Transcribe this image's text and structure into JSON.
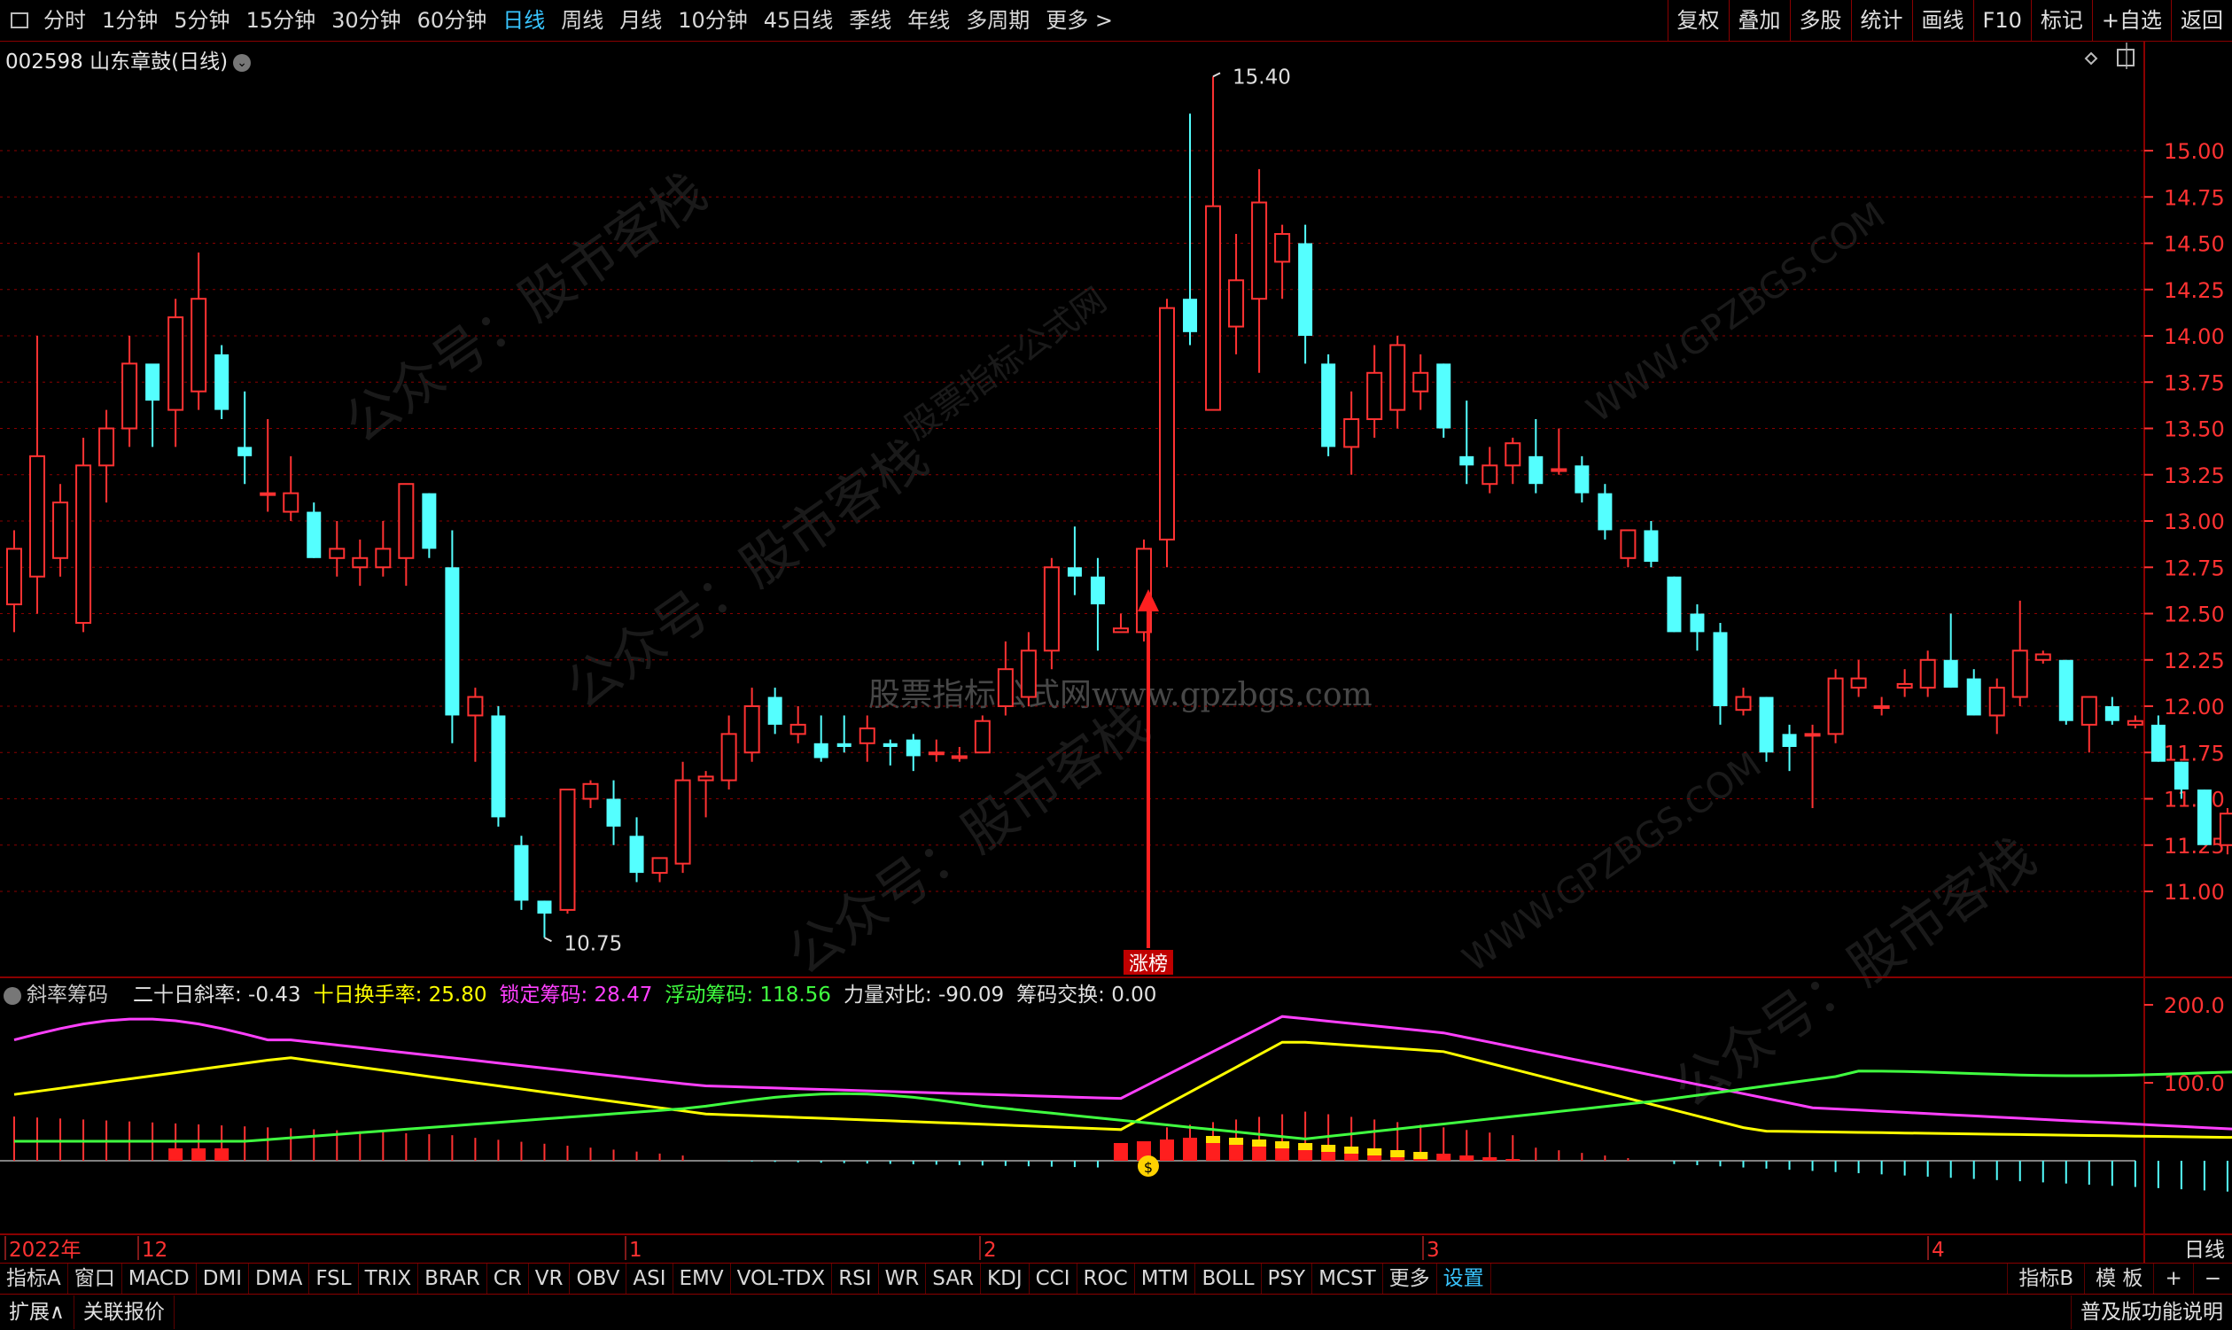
{
  "toolbar": {
    "periods": [
      "分时",
      "1分钟",
      "5分钟",
      "15分钟",
      "30分钟",
      "60分钟",
      "日线",
      "周线",
      "月线",
      "10分钟",
      "45日线",
      "季线",
      "年线",
      "多周期",
      "更多 >"
    ],
    "active_period": "日线",
    "right_buttons": [
      "复权",
      "叠加",
      "多股",
      "统计",
      "画线",
      "F10",
      "标记",
      "+自选",
      "返回"
    ]
  },
  "stock": {
    "title": "002598 山东章鼓(日线)"
  },
  "indicator": {
    "name": "斜率筹码",
    "values": [
      {
        "label": "二十日斜率: -0.43",
        "color": "#e0e0e0"
      },
      {
        "label": "十日换手率: 25.80",
        "color": "#ffff00"
      },
      {
        "label": "锁定筹码: 28.47",
        "color": "#ff40ff"
      },
      {
        "label": "浮动筹码: 118.56",
        "color": "#40ff40"
      },
      {
        "label": "力量对比: -90.09",
        "color": "#e0e0e0"
      },
      {
        "label": "筹码交换: 0.00",
        "color": "#e0e0e0"
      }
    ]
  },
  "bottom_tabs": [
    "指标A",
    "窗口",
    "MACD",
    "DMI",
    "DMA",
    "FSL",
    "TRIX",
    "BRAR",
    "CR",
    "VR",
    "OBV",
    "ASI",
    "EMV",
    "VOL-TDX",
    "RSI",
    "WR",
    "SAR",
    "KDJ",
    "CCI",
    "ROC",
    "MTM",
    "BOLL",
    "PSY",
    "MCST",
    "更多",
    "设置"
  ],
  "bottom_active": "设置",
  "bottom_right": [
    "指标B",
    "模 板",
    "+",
    "−"
  ],
  "status": {
    "left": [
      "扩展∧",
      "关联报价"
    ],
    "right": "普及版功能说明"
  },
  "watermarks": [
    "公众号：股市客栈",
    "股票指标公式网",
    "WWW.GPZBGS.COM"
  ],
  "watermark_center": "股票指标公式网www.gpzbgs.com",
  "colors": {
    "up": "#ff3232",
    "down": "#54ffff",
    "grid": "#8a0000",
    "axis": "#ff3232"
  },
  "chart_data": {
    "type": "candlestick",
    "price_axis": {
      "ticks": [
        11.0,
        11.25,
        11.5,
        11.75,
        12.0,
        12.25,
        12.5,
        12.75,
        13.0,
        13.25,
        13.5,
        13.75,
        14.0,
        14.25,
        14.5,
        14.75,
        15.0
      ],
      "ylim": [
        10.55,
        15.45
      ]
    },
    "indicator_axis": {
      "ticks": [
        100.0,
        200.0
      ]
    },
    "x_labels": [
      "2022年",
      "12",
      "1",
      "2",
      "3",
      "4"
    ],
    "period_label": "日线",
    "annotations": {
      "high": "15.40",
      "low": "10.75",
      "event": "涨榜"
    },
    "candles": [
      {
        "o": 12.55,
        "h": 12.95,
        "l": 12.4,
        "c": 12.85
      },
      {
        "o": 12.7,
        "h": 14.0,
        "l": 12.5,
        "c": 13.35
      },
      {
        "o": 12.8,
        "h": 13.2,
        "l": 12.7,
        "c": 13.1
      },
      {
        "o": 12.45,
        "h": 13.45,
        "l": 12.4,
        "c": 13.3
      },
      {
        "o": 13.3,
        "h": 13.6,
        "l": 13.1,
        "c": 13.5
      },
      {
        "o": 13.5,
        "h": 14.0,
        "l": 13.4,
        "c": 13.85
      },
      {
        "o": 13.85,
        "h": 13.75,
        "l": 13.4,
        "c": 13.65
      },
      {
        "o": 13.6,
        "h": 14.2,
        "l": 13.4,
        "c": 14.1
      },
      {
        "o": 13.7,
        "h": 14.45,
        "l": 13.6,
        "c": 14.2
      },
      {
        "o": 13.9,
        "h": 13.95,
        "l": 13.55,
        "c": 13.6
      },
      {
        "o": 13.4,
        "h": 13.7,
        "l": 13.2,
        "c": 13.35
      },
      {
        "o": 13.15,
        "h": 13.55,
        "l": 13.05,
        "c": 13.15
      },
      {
        "o": 13.05,
        "h": 13.35,
        "l": 13.0,
        "c": 13.15
      },
      {
        "o": 13.05,
        "h": 13.1,
        "l": 12.8,
        "c": 12.8
      },
      {
        "o": 12.8,
        "h": 13.0,
        "l": 12.7,
        "c": 12.85
      },
      {
        "o": 12.75,
        "h": 12.9,
        "l": 12.65,
        "c": 12.8
      },
      {
        "o": 12.75,
        "h": 13.0,
        "l": 12.7,
        "c": 12.85
      },
      {
        "o": 12.8,
        "h": 13.2,
        "l": 12.65,
        "c": 13.2
      },
      {
        "o": 13.15,
        "h": 13.15,
        "l": 12.8,
        "c": 12.85
      },
      {
        "o": 12.75,
        "h": 12.95,
        "l": 11.8,
        "c": 11.95
      },
      {
        "o": 11.95,
        "h": 12.1,
        "l": 11.7,
        "c": 12.05
      },
      {
        "o": 11.95,
        "h": 12.0,
        "l": 11.35,
        "c": 11.4
      },
      {
        "o": 11.25,
        "h": 11.3,
        "l": 10.9,
        "c": 10.95
      },
      {
        "o": 10.95,
        "h": 10.95,
        "l": 10.75,
        "c": 10.88
      },
      {
        "o": 10.9,
        "h": 11.55,
        "l": 10.88,
        "c": 11.55
      },
      {
        "o": 11.5,
        "h": 11.6,
        "l": 11.45,
        "c": 11.58
      },
      {
        "o": 11.5,
        "h": 11.6,
        "l": 11.25,
        "c": 11.35
      },
      {
        "o": 11.3,
        "h": 11.4,
        "l": 11.05,
        "c": 11.1
      },
      {
        "o": 11.1,
        "h": 11.15,
        "l": 11.05,
        "c": 11.18
      },
      {
        "o": 11.15,
        "h": 11.7,
        "l": 11.1,
        "c": 11.6
      },
      {
        "o": 11.6,
        "h": 11.65,
        "l": 11.4,
        "c": 11.62
      },
      {
        "o": 11.6,
        "h": 11.95,
        "l": 11.55,
        "c": 11.85
      },
      {
        "o": 11.75,
        "h": 12.1,
        "l": 11.7,
        "c": 12.0
      },
      {
        "o": 12.05,
        "h": 12.1,
        "l": 11.85,
        "c": 11.9
      },
      {
        "o": 11.85,
        "h": 12.0,
        "l": 11.8,
        "c": 11.9
      },
      {
        "o": 11.8,
        "h": 11.95,
        "l": 11.7,
        "c": 11.72
      },
      {
        "o": 11.8,
        "h": 11.95,
        "l": 11.75,
        "c": 11.78
      },
      {
        "o": 11.8,
        "h": 11.95,
        "l": 11.7,
        "c": 11.88
      },
      {
        "o": 11.8,
        "h": 11.82,
        "l": 11.68,
        "c": 11.78
      },
      {
        "o": 11.82,
        "h": 11.85,
        "l": 11.65,
        "c": 11.73
      },
      {
        "o": 11.75,
        "h": 11.82,
        "l": 11.7,
        "c": 11.75
      },
      {
        "o": 11.72,
        "h": 11.78,
        "l": 11.7,
        "c": 11.73
      },
      {
        "o": 11.75,
        "h": 11.95,
        "l": 11.75,
        "c": 11.92
      },
      {
        "o": 12.0,
        "h": 12.35,
        "l": 11.95,
        "c": 12.2
      },
      {
        "o": 12.05,
        "h": 12.4,
        "l": 12.0,
        "c": 12.3
      },
      {
        "o": 12.3,
        "h": 12.8,
        "l": 12.2,
        "c": 12.75
      },
      {
        "o": 12.75,
        "h": 12.97,
        "l": 12.6,
        "c": 12.7
      },
      {
        "o": 12.7,
        "h": 12.8,
        "l": 12.3,
        "c": 12.55
      },
      {
        "o": 12.4,
        "h": 12.5,
        "l": 12.4,
        "c": 12.42
      },
      {
        "o": 12.4,
        "h": 12.9,
        "l": 12.35,
        "c": 12.85
      },
      {
        "o": 12.9,
        "h": 14.2,
        "l": 12.75,
        "c": 14.15
      },
      {
        "o": 14.2,
        "h": 15.2,
        "l": 13.95,
        "c": 14.02
      },
      {
        "o": 13.6,
        "h": 15.4,
        "l": 13.6,
        "c": 14.7
      },
      {
        "o": 14.05,
        "h": 14.55,
        "l": 13.9,
        "c": 14.3
      },
      {
        "o": 14.2,
        "h": 14.9,
        "l": 13.8,
        "c": 14.72
      },
      {
        "o": 14.4,
        "h": 14.6,
        "l": 14.2,
        "c": 14.55
      },
      {
        "o": 14.5,
        "h": 14.6,
        "l": 13.85,
        "c": 14.0
      },
      {
        "o": 13.85,
        "h": 13.9,
        "l": 13.35,
        "c": 13.4
      },
      {
        "o": 13.4,
        "h": 13.7,
        "l": 13.25,
        "c": 13.55
      },
      {
        "o": 13.55,
        "h": 13.95,
        "l": 13.45,
        "c": 13.8
      },
      {
        "o": 13.6,
        "h": 14.0,
        "l": 13.5,
        "c": 13.95
      },
      {
        "o": 13.7,
        "h": 13.9,
        "l": 13.6,
        "c": 13.8
      },
      {
        "o": 13.85,
        "h": 13.85,
        "l": 13.45,
        "c": 13.5
      },
      {
        "o": 13.35,
        "h": 13.65,
        "l": 13.2,
        "c": 13.3
      },
      {
        "o": 13.2,
        "h": 13.4,
        "l": 13.15,
        "c": 13.3
      },
      {
        "o": 13.3,
        "h": 13.45,
        "l": 13.2,
        "c": 13.42
      },
      {
        "o": 13.35,
        "h": 13.55,
        "l": 13.15,
        "c": 13.2
      },
      {
        "o": 13.27,
        "h": 13.5,
        "l": 13.25,
        "c": 13.28
      },
      {
        "o": 13.3,
        "h": 13.35,
        "l": 13.1,
        "c": 13.15
      },
      {
        "o": 13.15,
        "h": 13.2,
        "l": 12.9,
        "c": 12.95
      },
      {
        "o": 12.8,
        "h": 12.95,
        "l": 12.75,
        "c": 12.95
      },
      {
        "o": 12.95,
        "h": 13.0,
        "l": 12.75,
        "c": 12.78
      },
      {
        "o": 12.7,
        "h": 12.7,
        "l": 12.4,
        "c": 12.4
      },
      {
        "o": 12.5,
        "h": 12.55,
        "l": 12.3,
        "c": 12.4
      },
      {
        "o": 12.4,
        "h": 12.45,
        "l": 11.9,
        "c": 12.0
      },
      {
        "o": 11.98,
        "h": 12.1,
        "l": 11.95,
        "c": 12.05
      },
      {
        "o": 12.05,
        "h": 12.05,
        "l": 11.7,
        "c": 11.75
      },
      {
        "o": 11.85,
        "h": 11.9,
        "l": 11.65,
        "c": 11.78
      },
      {
        "o": 11.85,
        "h": 11.9,
        "l": 11.45,
        "c": 11.85
      },
      {
        "o": 11.85,
        "h": 12.2,
        "l": 11.8,
        "c": 12.15
      },
      {
        "o": 12.1,
        "h": 12.25,
        "l": 12.05,
        "c": 12.15
      },
      {
        "o": 12.0,
        "h": 12.05,
        "l": 11.95,
        "c": 12.0
      },
      {
        "o": 12.1,
        "h": 12.2,
        "l": 12.05,
        "c": 12.12
      },
      {
        "o": 12.1,
        "h": 12.3,
        "l": 12.05,
        "c": 12.25
      },
      {
        "o": 12.25,
        "h": 12.5,
        "l": 12.1,
        "c": 12.1
      },
      {
        "o": 12.15,
        "h": 12.2,
        "l": 11.95,
        "c": 11.95
      },
      {
        "o": 11.95,
        "h": 12.15,
        "l": 11.85,
        "c": 12.1
      },
      {
        "o": 12.05,
        "h": 12.57,
        "l": 12.0,
        "c": 12.3
      },
      {
        "o": 12.25,
        "h": 12.3,
        "l": 12.23,
        "c": 12.28
      },
      {
        "o": 12.25,
        "h": 12.25,
        "l": 11.9,
        "c": 11.92
      },
      {
        "o": 11.9,
        "h": 12.05,
        "l": 11.75,
        "c": 12.05
      },
      {
        "o": 12.0,
        "h": 12.05,
        "l": 11.9,
        "c": 11.92
      },
      {
        "o": 11.9,
        "h": 11.95,
        "l": 11.88,
        "c": 11.92
      },
      {
        "o": 11.9,
        "h": 11.95,
        "l": 11.7,
        "c": 11.7
      },
      {
        "o": 11.7,
        "h": 11.7,
        "l": 11.5,
        "c": 11.55
      },
      {
        "o": 11.55,
        "h": 11.55,
        "l": 11.25,
        "c": 11.25
      },
      {
        "o": 11.25,
        "h": 11.45,
        "l": 11.2,
        "c": 11.42
      },
      {
        "o": 11.42,
        "h": 11.55,
        "l": 11.38,
        "c": 11.45
      }
    ],
    "series": [
      {
        "color": "#ff40ff"
      },
      {
        "color": "#ffff00"
      },
      {
        "color": "#40ff40"
      }
    ]
  }
}
